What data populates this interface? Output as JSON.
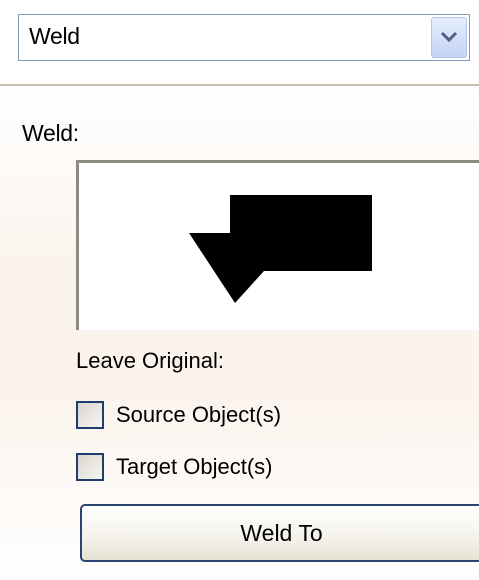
{
  "dropdown": {
    "selected": "Weld",
    "icon": "chevron-down-icon"
  },
  "panel": {
    "title": "Weld:",
    "leave_original_label": "Leave Original:",
    "options": [
      {
        "label": "Source Object(s)",
        "checked": false
      },
      {
        "label": "Target Object(s)",
        "checked": false
      }
    ],
    "action_button": "Weld To"
  }
}
